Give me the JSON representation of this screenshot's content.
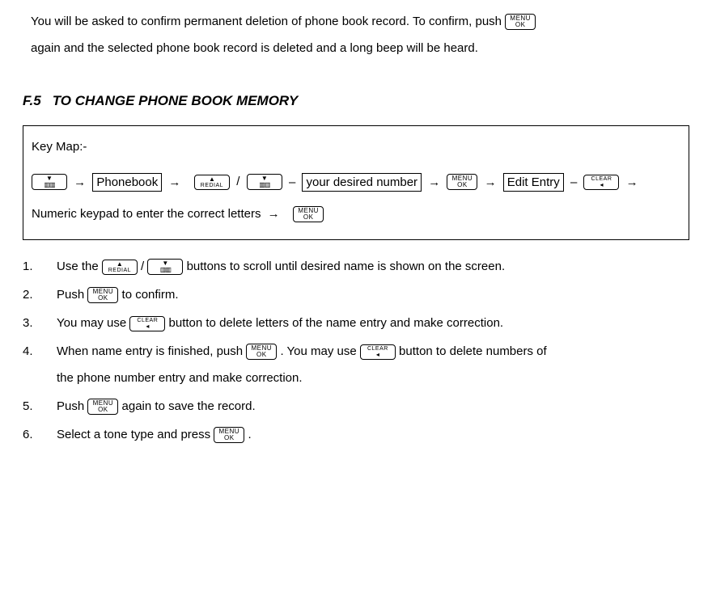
{
  "intro": {
    "line1_pre": "You will be asked to confirm permanent deletion of phone book record. To confirm, push ",
    "line2": "again and the selected phone book record is deleted and a long beep will be heard."
  },
  "section": {
    "num": "F.5",
    "title": "TO CHANGE PHONE BOOK MEMORY"
  },
  "keymap": {
    "title": "Key Map:-",
    "phonebook": "Phonebook",
    "desired": "your desired number",
    "edit_entry": "Edit Entry",
    "numeric_text": "Numeric keypad to enter the correct letters"
  },
  "arrows": {
    "right": "→",
    "dash": "–",
    "slash": "/"
  },
  "buttons": {
    "menu": "MENU",
    "ok": "OK",
    "redial": "REDIAL",
    "clear": "CLEAR"
  },
  "steps": [
    {
      "n": "1.",
      "pre": "Use the ",
      "mid": " / ",
      "post": " buttons to scroll until desired name is shown on the screen."
    },
    {
      "n": "2.",
      "pre": "Push ",
      "post": " to confirm."
    },
    {
      "n": "3.",
      "pre": "You may use ",
      "post": " button to delete letters of the name entry and make correction."
    },
    {
      "n": "4.",
      "pre": "When name entry is finished, push ",
      "mid": ". You may use ",
      "post": " button to delete numbers of",
      "cont": "the phone number entry and make correction."
    },
    {
      "n": "5.",
      "pre": "Push ",
      "post": " again to save the record."
    },
    {
      "n": "6.",
      "pre": "Select a tone type and press ",
      "post": "."
    }
  ]
}
